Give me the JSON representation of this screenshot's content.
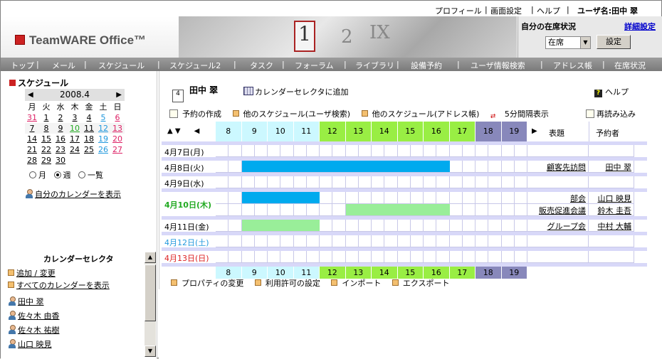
{
  "top_links": [
    "プロフィール",
    "画面設定",
    "ヘルプ"
  ],
  "user_label": "ユーザ名:田中 翠",
  "app_logo": "TeamWARE Office™",
  "banner_numbers": [
    "1",
    "2",
    "IX"
  ],
  "status": {
    "title": "自分の在席状況",
    "detail": "詳細設定",
    "selected": "在席",
    "set_button": "設定"
  },
  "nav": [
    "トップ",
    "メール",
    "スケジュール",
    "スケジュール2",
    "タスク",
    "フォーラム",
    "ライブラリ",
    "設備予約",
    "ユーザ情報検索",
    "アドレス帳",
    "在席状況"
  ],
  "sidebar": {
    "title": "スケジュール",
    "month": "2008.4",
    "weekdays": [
      "月",
      "火",
      "水",
      "木",
      "金",
      "土",
      "日"
    ],
    "weeks": [
      [
        "31",
        "1",
        "2",
        "3",
        "4",
        "5",
        "6"
      ],
      [
        "7",
        "8",
        "9",
        "10",
        "11",
        "12",
        "13"
      ],
      [
        "14",
        "15",
        "16",
        "17",
        "18",
        "19",
        "20"
      ],
      [
        "21",
        "22",
        "23",
        "24",
        "25",
        "26",
        "27"
      ],
      [
        "28",
        "29",
        "30",
        "",
        "",
        "",
        ""
      ]
    ],
    "view_opts": [
      "月",
      "週",
      "一覧"
    ],
    "show_my_calendar": "自分のカレンダーを表示",
    "selector_title": "カレンダーセレクタ",
    "selector_links": [
      "追加 / 変更",
      "すべてのカレンダーを表示"
    ],
    "people": [
      "田中 翠",
      "佐々木 由香",
      "佐々木 祐樹",
      "山口 映見"
    ]
  },
  "main": {
    "user": "田中 翠",
    "cal_icon": "4",
    "add_selector": "カレンダーセレクタに追加",
    "help": "ヘルプ",
    "actions": [
      "予約の作成",
      "他のスケジュール(ユーザ検索)",
      "他のスケジュール(アドレス帳)"
    ],
    "five_min": "5分間隔表示",
    "reload": "再読み込み",
    "col_title": "表題",
    "col_booker": "予約者",
    "hours": [
      "8",
      "9",
      "10",
      "11",
      "12",
      "13",
      "14",
      "15",
      "16",
      "17",
      "18",
      "19"
    ],
    "days": [
      {
        "label": "4月7日(月)",
        "color": "#000000",
        "items": []
      },
      {
        "label": "4月8日(火)",
        "color": "#000000",
        "items": [
          {
            "title": "顧客先訪問",
            "booker": "田中 翠",
            "start": 9,
            "end": 17,
            "bar": "#00aaee"
          }
        ]
      },
      {
        "label": "4月9日(水)",
        "color": "#000000",
        "items": []
      },
      {
        "label": "4月10日(木)",
        "color": "#22aa22",
        "bold": true,
        "items": [
          {
            "title": "部会",
            "booker": "山口 映見",
            "start": 9,
            "end": 12,
            "bar": "#00aaee"
          },
          {
            "title": "販売促進会議",
            "booker": "鈴木 圭吾",
            "start": 13,
            "end": 17,
            "bar": "#99ee99"
          }
        ]
      },
      {
        "label": "4月11日(金)",
        "color": "#000000",
        "items": [
          {
            "title": "グループ会",
            "booker": "中村 大輔",
            "start": 9,
            "end": 12,
            "bar": "#99ee99"
          }
        ]
      },
      {
        "label": "4月12日(土)",
        "color": "#2299dd",
        "items": []
      },
      {
        "label": "4月13日(日)",
        "color": "#dd2222",
        "items": []
      }
    ],
    "footer": [
      "プロパティの変更",
      "利用許可の設定",
      "インポート",
      "エクスポート"
    ]
  },
  "colors": {
    "hour_am": "#ccf8ff",
    "hour_mid": "#99ee44",
    "hour_pm": "#8888bb",
    "row_sep": "#d8d8f8"
  }
}
